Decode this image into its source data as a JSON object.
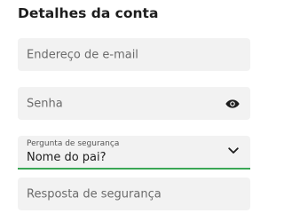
{
  "section": {
    "title": "Detalhes da conta"
  },
  "fields": {
    "email": {
      "placeholder": "Endereço de e-mail"
    },
    "password": {
      "placeholder": "Senha",
      "toggle_icon": "eye-icon"
    },
    "security_question": {
      "label": "Pergunta de segurança",
      "selected": "Nome do pai?",
      "icon": "chevron-down-icon",
      "accent": "#3aa655"
    },
    "security_answer": {
      "placeholder": "Resposta de segurança"
    }
  }
}
